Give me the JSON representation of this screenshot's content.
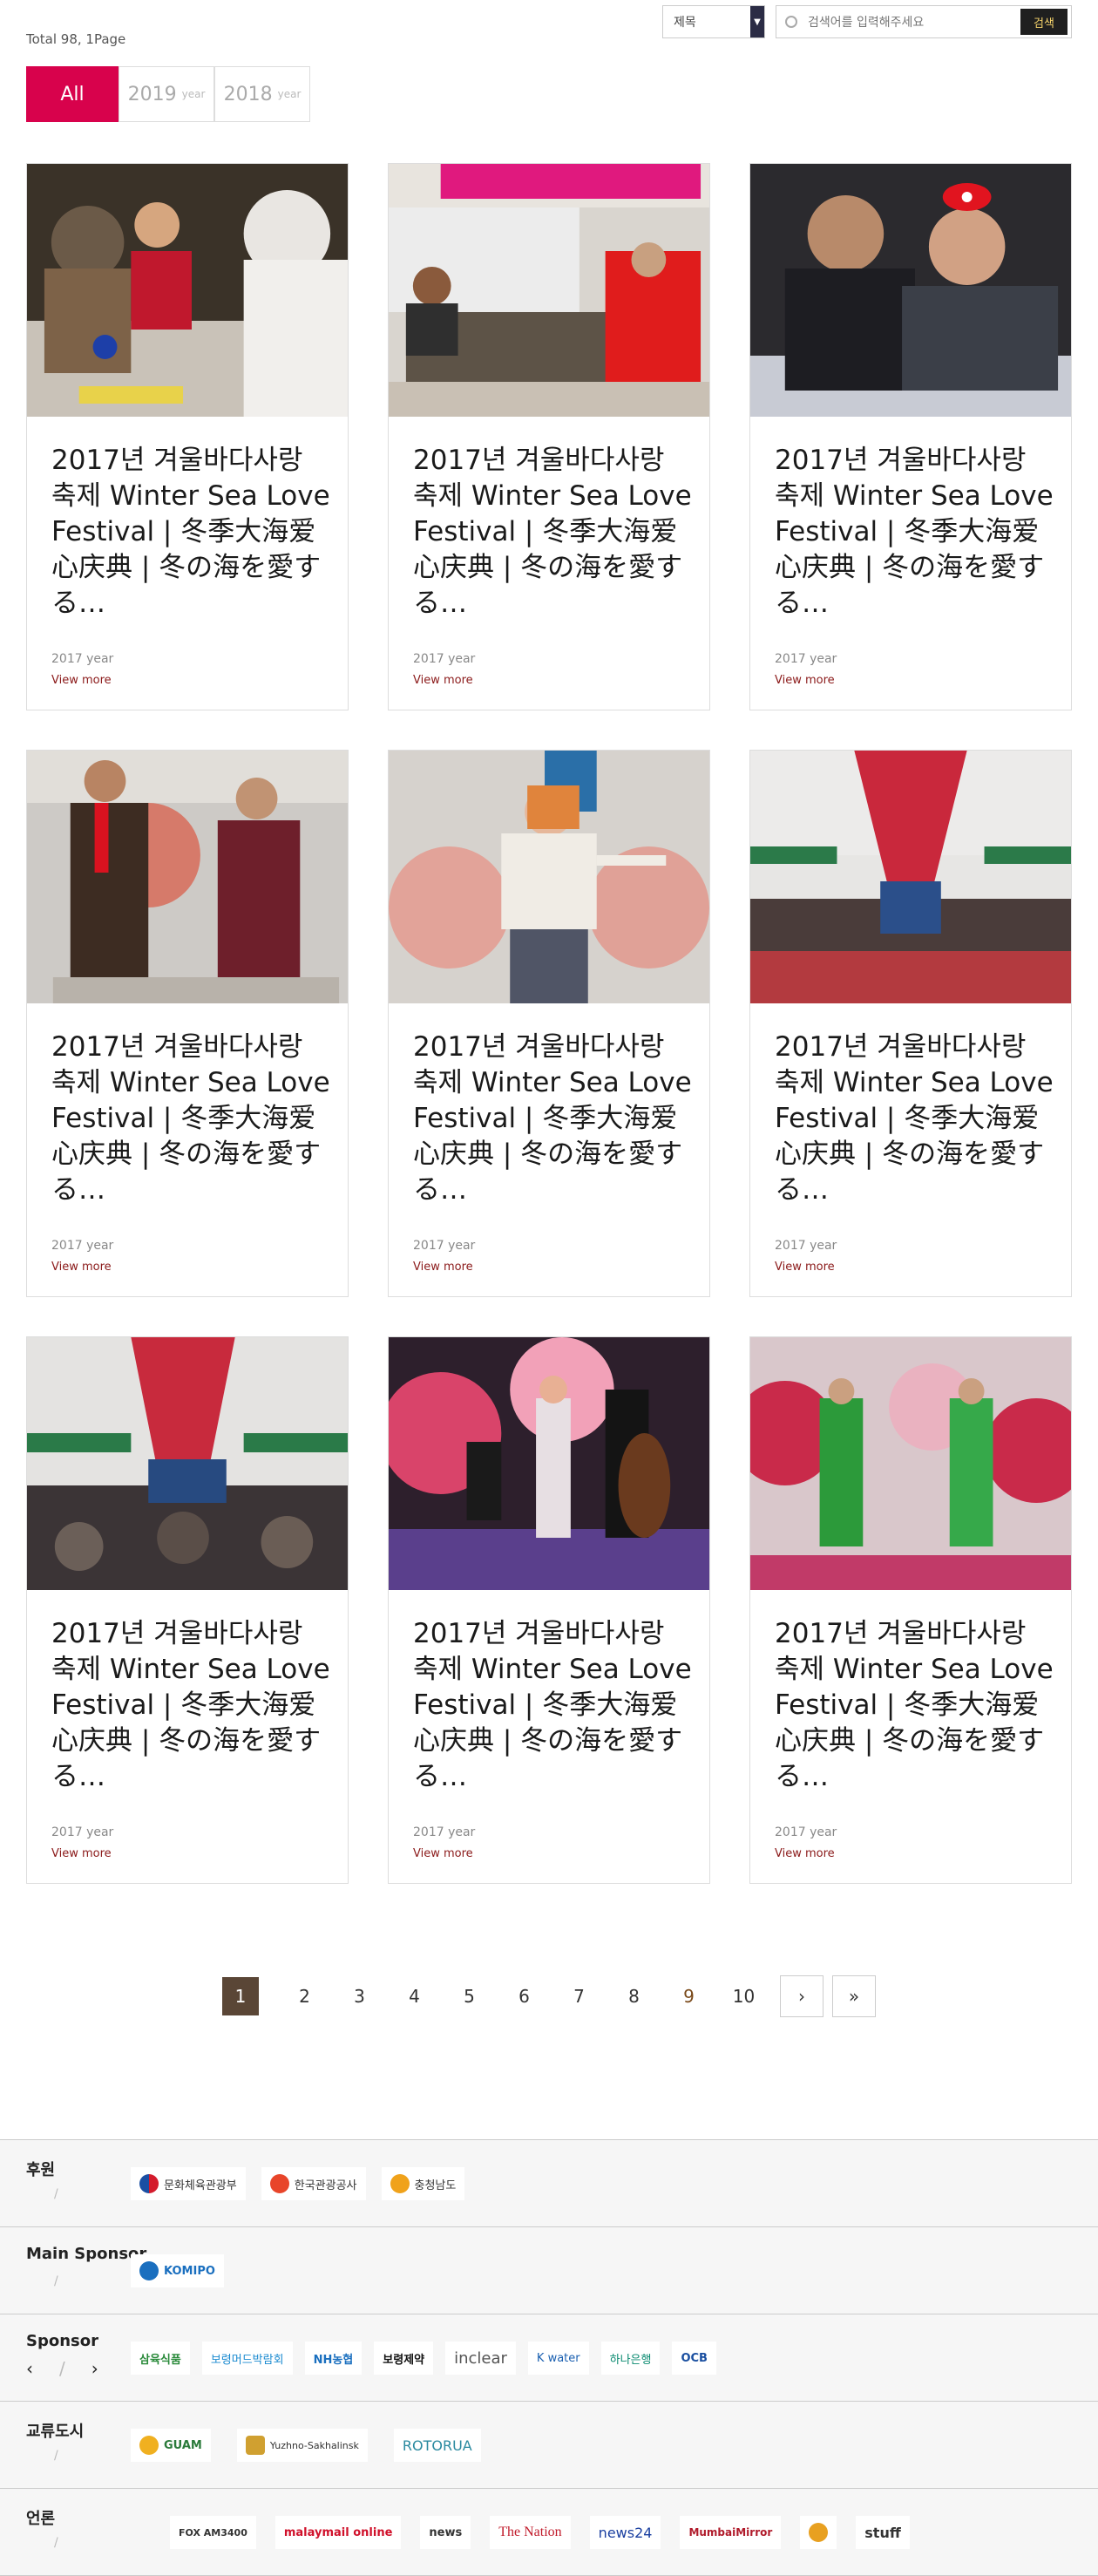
{
  "total": "Total 98, 1Page",
  "search": {
    "select_value": "제목",
    "placeholder": "검색어를 입력해주세요",
    "button": "검색"
  },
  "tabs": [
    {
      "label": "All",
      "suffix": ""
    },
    {
      "label": "2019",
      "suffix": "year"
    },
    {
      "label": "2018",
      "suffix": "year"
    }
  ],
  "cards": [
    {
      "title": "2017년 겨울바다사랑 축제 Winter Sea Love Festival | 冬季大海爱心庆典 | 冬の海を愛する…",
      "year": "2017 year",
      "more": "View more",
      "photo": "crowd-craft-table"
    },
    {
      "title": "2017년 겨울바다사랑 축제 Winter Sea Love Festival | 冬季大海爱心庆典 | 冬の海を愛する…",
      "year": "2017 year",
      "more": "View more",
      "photo": "craft-booth"
    },
    {
      "title": "2017년 겨울바다사랑 축제 Winter Sea Love Festival | 冬季大海爱心庆典 | 冬の海を愛する…",
      "year": "2017 year",
      "more": "View more",
      "photo": "couple"
    },
    {
      "title": "2017년 겨울바다사랑 축제 Winter Sea Love Festival | 冬季大海爱心庆典 | 冬の海を愛する…",
      "year": "2017 year",
      "more": "View more",
      "photo": "mc-duo"
    },
    {
      "title": "2017년 겨울바다사랑 축제 Winter Sea Love Festival | 冬季大海爱心庆典 | 冬の海を愛する…",
      "year": "2017 year",
      "more": "View more",
      "photo": "singer"
    },
    {
      "title": "2017년 겨울바다사랑 축제 Winter Sea Love Festival | 冬季大海爱心庆典 | 冬の海を愛する…",
      "year": "2017 year",
      "more": "View more",
      "photo": "tent-stage"
    },
    {
      "title": "2017년 겨울바다사랑 축제 Winter Sea Love Festival | 冬季大海爱心庆典 | 冬の海を愛する…",
      "year": "2017 year",
      "more": "View more",
      "photo": "tent-audience"
    },
    {
      "title": "2017년 겨울바다사랑 축제 Winter Sea Love Festival | 冬季大海爱心庆典 | 冬の海を愛する…",
      "year": "2017 year",
      "more": "View more",
      "photo": "jazz-band"
    },
    {
      "title": "2017년 겨울바다사랑 축제 Winter Sea Love Festival | 冬季大海爱心庆典 | 冬の海を愛する…",
      "year": "2017 year",
      "more": "View more",
      "photo": "green-performers"
    }
  ],
  "pagination": {
    "pages": [
      "1",
      "2",
      "3",
      "4",
      "5",
      "6",
      "7",
      "8",
      "9",
      "10"
    ],
    "current": "1",
    "next": "›",
    "last": "»"
  },
  "sponsor_rows": [
    {
      "label": "후원",
      "logos": [
        "문화체육관광부",
        "한국관광공사",
        "충청남도"
      ]
    },
    {
      "label": "Main Sponsor",
      "logos": [
        "KOMIPO"
      ]
    },
    {
      "label": "Sponsor",
      "nav": [
        "‹",
        "/",
        "›"
      ],
      "logos": [
        "삼육식품",
        "보령머드박람회",
        "NH농협",
        "보령제약",
        "inclear",
        "K water",
        "하나은행",
        "OCB"
      ]
    },
    {
      "label": "교류도시",
      "logos": [
        "GUAM",
        "Yuzhno-Sakhalinsk",
        "ROTORUA"
      ]
    },
    {
      "label": "언론",
      "logos": [
        "FOX AM3400",
        "malaymail online",
        "news",
        "The Nation",
        "news24",
        "MumbaiMirror",
        "",
        "stuff"
      ]
    }
  ],
  "colors": {
    "accent": "#d8024c",
    "pager_current": "#5a4636",
    "more": "#8b1a1a"
  }
}
